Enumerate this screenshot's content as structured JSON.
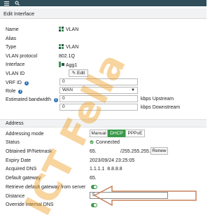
{
  "topbar": {
    "menu_icon": "hamburger-menu-icon",
    "search_icon": "search-icon"
  },
  "header": {
    "title": "Edit Interface"
  },
  "fields": {
    "name": {
      "label": "Name",
      "value": "VLAN"
    },
    "alias": {
      "label": "Alias",
      "value": ""
    },
    "type": {
      "label": "Type",
      "value": "VLAN"
    },
    "vlan_protocol": {
      "label": "VLAN protocol",
      "value": "802.1Q"
    },
    "interface": {
      "label": "Interface",
      "value": "Agg1"
    },
    "vlan_id": {
      "label": "VLAN ID",
      "button": "Edit"
    },
    "vrf_id": {
      "label": "VRF ID",
      "value": "0"
    },
    "role": {
      "label": "Role",
      "value": "WAN"
    },
    "bandwidth": {
      "label": "Estimated bandwidth",
      "upstream_value": "0",
      "upstream_unit": "kbps Upstream",
      "downstream_value": "0",
      "downstream_unit": "kbps Downstream"
    }
  },
  "address": {
    "section_title": "Address",
    "addressing_mode": {
      "label": "Addressing mode",
      "options": [
        "Manual",
        "DHCP",
        "PPPoE"
      ],
      "selected": "DHCP"
    },
    "status": {
      "label": "Status",
      "value": "Connected"
    },
    "obtained": {
      "label": "Obtained IP/Netmask",
      "ip": "65.",
      "netmask": "/255.255.255.0",
      "button": "Renew"
    },
    "expiry": {
      "label": "Expiry Date",
      "value": "2023/09/24 23:25:05"
    },
    "dns": {
      "label": "Acquired DNS",
      "value": "1.1.1.1  8.8.8.8"
    },
    "gateway": {
      "label": "Default gateway",
      "value": "65."
    },
    "retrieve_gw": {
      "label": "Retrieve default gateway from server",
      "enabled": true
    },
    "distance": {
      "label": "Distance",
      "value": "5"
    },
    "override_dns": {
      "label": "Override internal DNS",
      "enabled": true
    }
  },
  "watermark": {
    "text": "ICT Fella"
  },
  "colors": {
    "topbar": "#2f4e59",
    "accent_green": "#3c9a4b",
    "arrow": "#c9805a",
    "watermark": "#f0a028"
  }
}
